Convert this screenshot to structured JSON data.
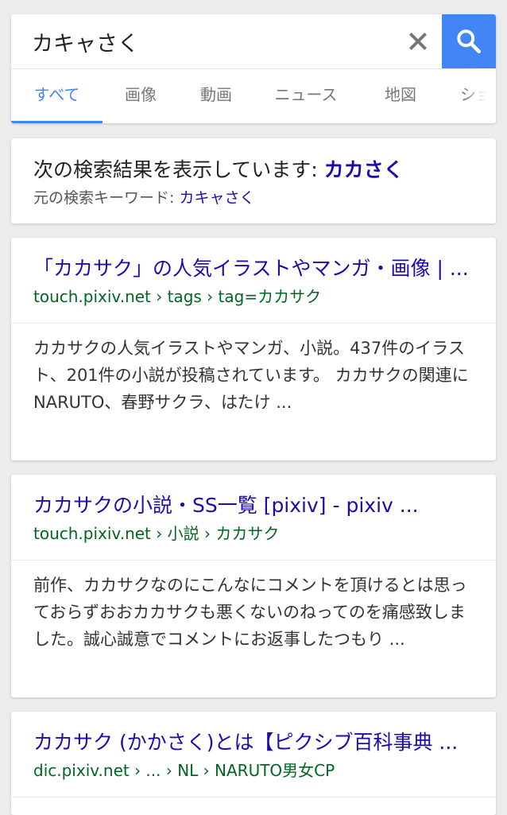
{
  "search": {
    "query": "カキャさく"
  },
  "tabs": [
    {
      "label": "すべて",
      "active": true
    },
    {
      "label": "画像",
      "active": false
    },
    {
      "label": "動画",
      "active": false
    },
    {
      "label": "ニュース",
      "active": false
    },
    {
      "label": "地図",
      "active": false
    },
    {
      "label": "ショ",
      "active": false
    }
  ],
  "spelling": {
    "showing_prefix": "次の検索結果を表示しています: ",
    "corrected_query": "カカさく",
    "original_prefix": "元の検索キーワード: ",
    "original_query": "カキャさく"
  },
  "results": [
    {
      "title": "「カカサク」の人気イラストやマンガ・画像 | ...",
      "url": "touch.pixiv.net › tags › tag=カカサク",
      "snippet": "カカサクの人気イラストやマンガ、小説。437件のイラスト、201件の小説が投稿されています。 カカサクの関連にNARUTO、春野サクラ、はたけ ..."
    },
    {
      "title": "カカサクの小説・SS一覧 [pixiv] - pixiv ...",
      "url": "touch.pixiv.net › 小説 › カカサク",
      "snippet": "前作、カカサクなのにこんなにコメントを頂けるとは思っておらずおおカカサクも悪くないのねってのを痛感致しました。誠心誠意でコメントにお返事したつもり ..."
    },
    {
      "title": "カカサク (かかさく)とは【ピクシブ百科事典 ...",
      "url": "dic.pixiv.net › ... › NL › NARUTO男女CP"
    }
  ],
  "colors": {
    "accent": "#4285f4",
    "link": "#1a0dab",
    "url_green": "#006621",
    "background": "#ececec"
  },
  "icons": {
    "clear": "close-icon",
    "search": "search-icon"
  }
}
